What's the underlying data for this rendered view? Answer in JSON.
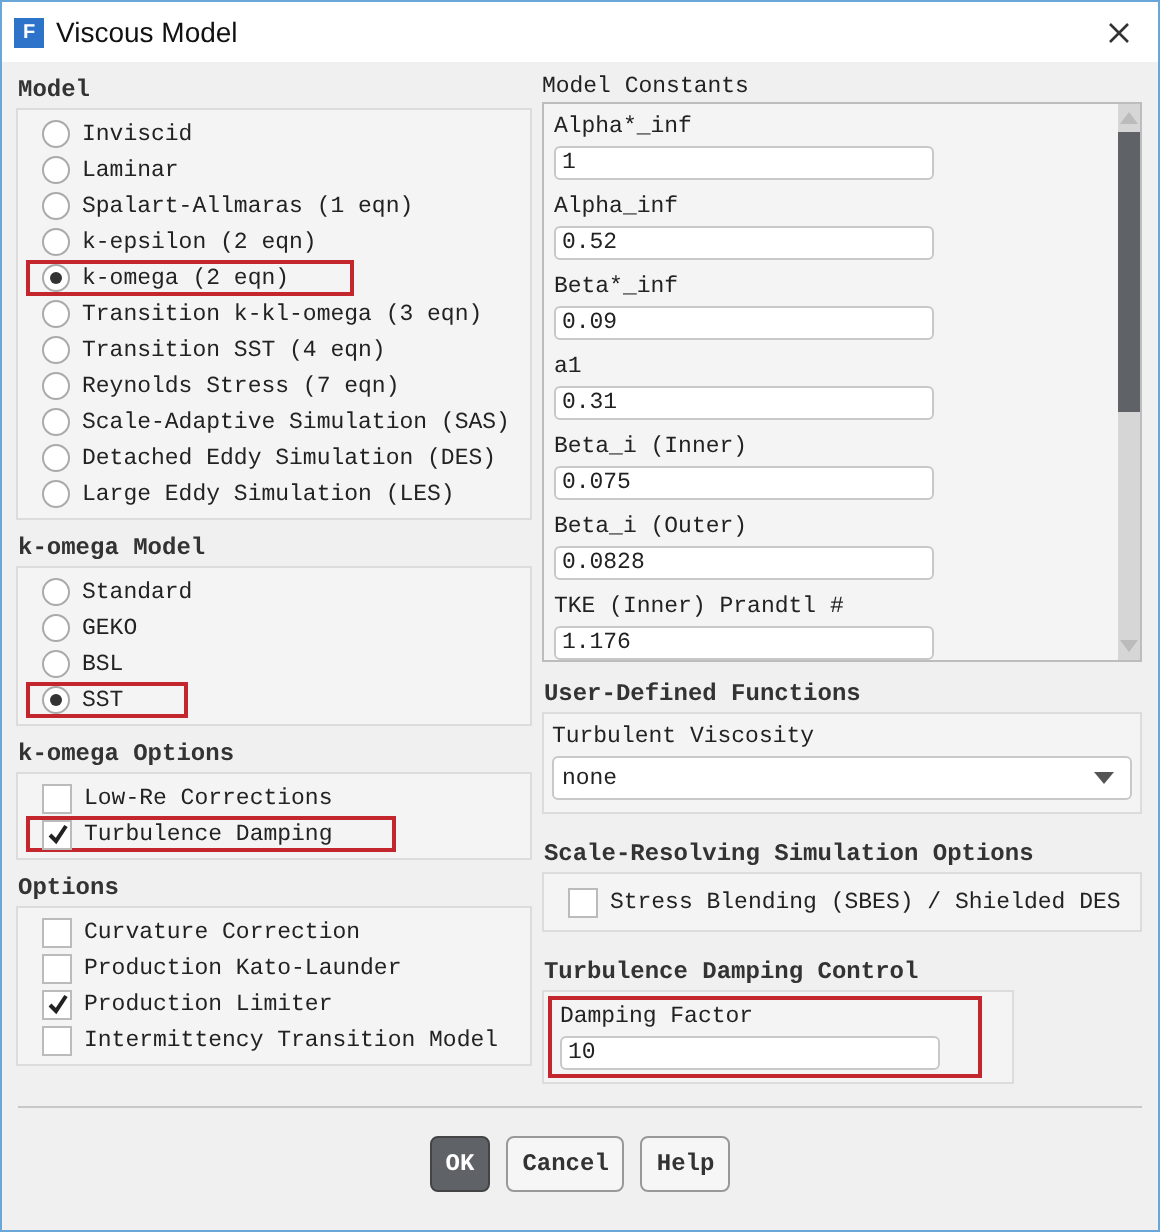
{
  "window": {
    "icon_letter": "F",
    "title": "Viscous Model"
  },
  "model": {
    "heading": "Model",
    "options": [
      {
        "label": "Inviscid",
        "selected": false,
        "highlighted": false
      },
      {
        "label": "Laminar",
        "selected": false,
        "highlighted": false
      },
      {
        "label": "Spalart-Allmaras (1 eqn)",
        "selected": false,
        "highlighted": false
      },
      {
        "label": "k-epsilon (2 eqn)",
        "selected": false,
        "highlighted": false
      },
      {
        "label": "k-omega (2 eqn)",
        "selected": true,
        "highlighted": true
      },
      {
        "label": "Transition k-kl-omega (3 eqn)",
        "selected": false,
        "highlighted": false
      },
      {
        "label": "Transition SST (4 eqn)",
        "selected": false,
        "highlighted": false
      },
      {
        "label": "Reynolds Stress (7 eqn)",
        "selected": false,
        "highlighted": false
      },
      {
        "label": "Scale-Adaptive Simulation (SAS)",
        "selected": false,
        "highlighted": false
      },
      {
        "label": "Detached Eddy Simulation (DES)",
        "selected": false,
        "highlighted": false
      },
      {
        "label": "Large Eddy Simulation (LES)",
        "selected": false,
        "highlighted": false
      }
    ]
  },
  "komega_model": {
    "heading": "k-omega Model",
    "options": [
      {
        "label": "Standard",
        "selected": false,
        "highlighted": false
      },
      {
        "label": "GEKO",
        "selected": false,
        "highlighted": false
      },
      {
        "label": "BSL",
        "selected": false,
        "highlighted": false
      },
      {
        "label": "SST",
        "selected": true,
        "highlighted": true
      }
    ]
  },
  "komega_options": {
    "heading": "k-omega Options",
    "options": [
      {
        "label": "Low-Re Corrections",
        "checked": false,
        "highlighted": false
      },
      {
        "label": "Turbulence Damping",
        "checked": true,
        "highlighted": true
      }
    ]
  },
  "options": {
    "heading": "Options",
    "options": [
      {
        "label": "Curvature Correction",
        "checked": false,
        "highlighted": false
      },
      {
        "label": "Production Kato-Launder",
        "checked": false,
        "highlighted": false
      },
      {
        "label": "Production Limiter",
        "checked": true,
        "highlighted": false
      },
      {
        "label": "Intermittency Transition Model",
        "checked": false,
        "highlighted": false
      }
    ]
  },
  "model_constants": {
    "heading": "Model Constants",
    "fields": [
      {
        "label": "Alpha*_inf",
        "value": "1"
      },
      {
        "label": "Alpha_inf",
        "value": "0.52"
      },
      {
        "label": "Beta*_inf",
        "value": "0.09"
      },
      {
        "label": "a1",
        "value": "0.31"
      },
      {
        "label": "Beta_i (Inner)",
        "value": "0.075"
      },
      {
        "label": "Beta_i (Outer)",
        "value": "0.0828"
      },
      {
        "label": "TKE (Inner) Prandtl #",
        "value": "1.176"
      }
    ]
  },
  "udf": {
    "heading": "User-Defined Functions",
    "label": "Turbulent Viscosity",
    "value": "none"
  },
  "scale_resolving": {
    "heading": "Scale-Resolving Simulation Options",
    "options": [
      {
        "label": "Stress Blending (SBES) / Shielded DES",
        "checked": false,
        "highlighted": false
      }
    ]
  },
  "damping_control": {
    "heading": "Turbulence Damping Control",
    "label": "Damping Factor",
    "value": "10",
    "highlighted": true
  },
  "buttons": [
    {
      "label": "OK",
      "primary": true
    },
    {
      "label": "Cancel",
      "primary": false
    },
    {
      "label": "Help",
      "primary": false
    }
  ]
}
